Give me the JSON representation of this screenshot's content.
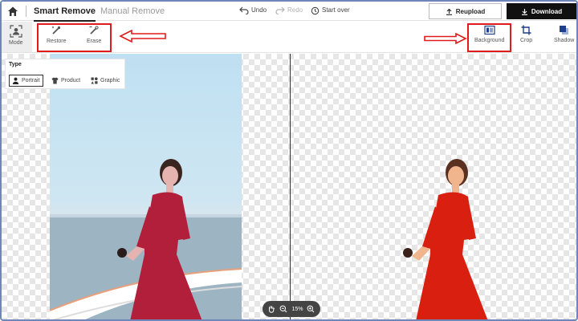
{
  "topbar": {
    "tab_smart": "Smart Remove",
    "tab_manual": "Manual Remove",
    "undo": "Undo",
    "redo": "Redo",
    "start_over": "Start over",
    "reupload": "Reupload",
    "download": "Download"
  },
  "toolbar": {
    "mode": "Mode",
    "restore": "Restore",
    "erase": "Erase",
    "background": "Background",
    "crop": "Crop",
    "shadow": "Shadow"
  },
  "type_panel": {
    "title": "Type",
    "options": [
      "Portrait",
      "Product",
      "Graphic"
    ],
    "selected": "Portrait"
  },
  "zoom": {
    "level": "15%"
  },
  "colors": {
    "highlight": "#e01b1b",
    "download_bg": "#111111",
    "frame": "#6f86b8"
  }
}
